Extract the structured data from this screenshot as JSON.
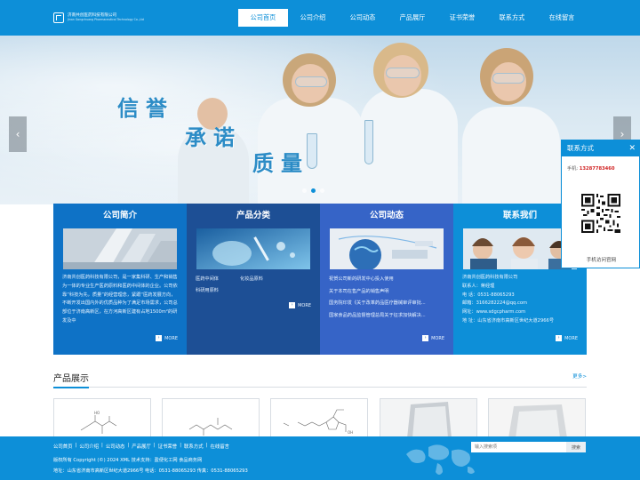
{
  "header": {
    "logo_cn": "济南共创医药科技有限公司",
    "logo_en": "Jinan Gongchuang Pharmaceutical Technology Co.,Ltd",
    "nav": [
      "公司首页",
      "公司介绍",
      "公司动态",
      "产品展厅",
      "证书荣誉",
      "联系方式",
      "在线留言"
    ],
    "active_nav": 0
  },
  "banner": {
    "slogan": [
      "信誉",
      "承诺",
      "质量"
    ],
    "prev_label": "‹",
    "next_label": "›",
    "slide_count": 3,
    "active_slide": 1
  },
  "panels": {
    "about": {
      "title": "公司简介",
      "text": "济南共创医药科技有限公司，是一家集科研、生产和销售为一体的专业生产医药原料和医药中间体的企业。公司依靠“科技为先，质量”的经营理念，紧跟“医药发展方向，不断开发出国内外的优质品种为了满足市场需求，公司总部位于济南高新区，在方河高新区建有占地1500m²的研发及中",
      "more": "MORE"
    },
    "categories": {
      "title": "产品分类",
      "items": [
        "医药中间体",
        "化妆品原料",
        "科研用原料"
      ],
      "more": "MORE"
    },
    "news": {
      "title": "公司动态",
      "items": [
        "祝贺公司新的研发中心投入使用",
        "关于本司在售产品的销售声明",
        "国务院印发《关于改革药品医疗器械审评审批...",
        "国家食品药品监督管理总局关于征求加快解决..."
      ],
      "more": "MORE"
    },
    "contact": {
      "title": "联系我们",
      "company": "济南共创医药科技有限公司",
      "person": "联系人：蒋经理",
      "tel": "电 话：0531-88065293",
      "email": "邮箱：3166282224@qq.com",
      "web": "网址：www.sdgcpharm.com",
      "address": "地 址：山东省济南市高新区世纪大道2966号",
      "more": "MORE"
    }
  },
  "products": {
    "title": "产品展示",
    "more": "更多>"
  },
  "footer": {
    "links": [
      "公司首页",
      "公司介绍",
      "公司动态",
      "产品展厅",
      "证书荣誉",
      "联系方式",
      "在线留言"
    ],
    "separator": "|",
    "copyright": "版权所有 Copyright (©) 2024 XML 技术支持：盈便化工网  食品商务网",
    "address_line": "地址：山东省济南市高新区世纪大道2966号   电话：0531-88065293   传真：0531-88065293",
    "search_placeholder": "输入搜索项",
    "search_button": "搜索"
  },
  "float_contact": {
    "title": "联系方式",
    "close": "✕",
    "phone_label": "手机:",
    "phone": "13287783460",
    "qr_caption": "手机访问官网"
  }
}
